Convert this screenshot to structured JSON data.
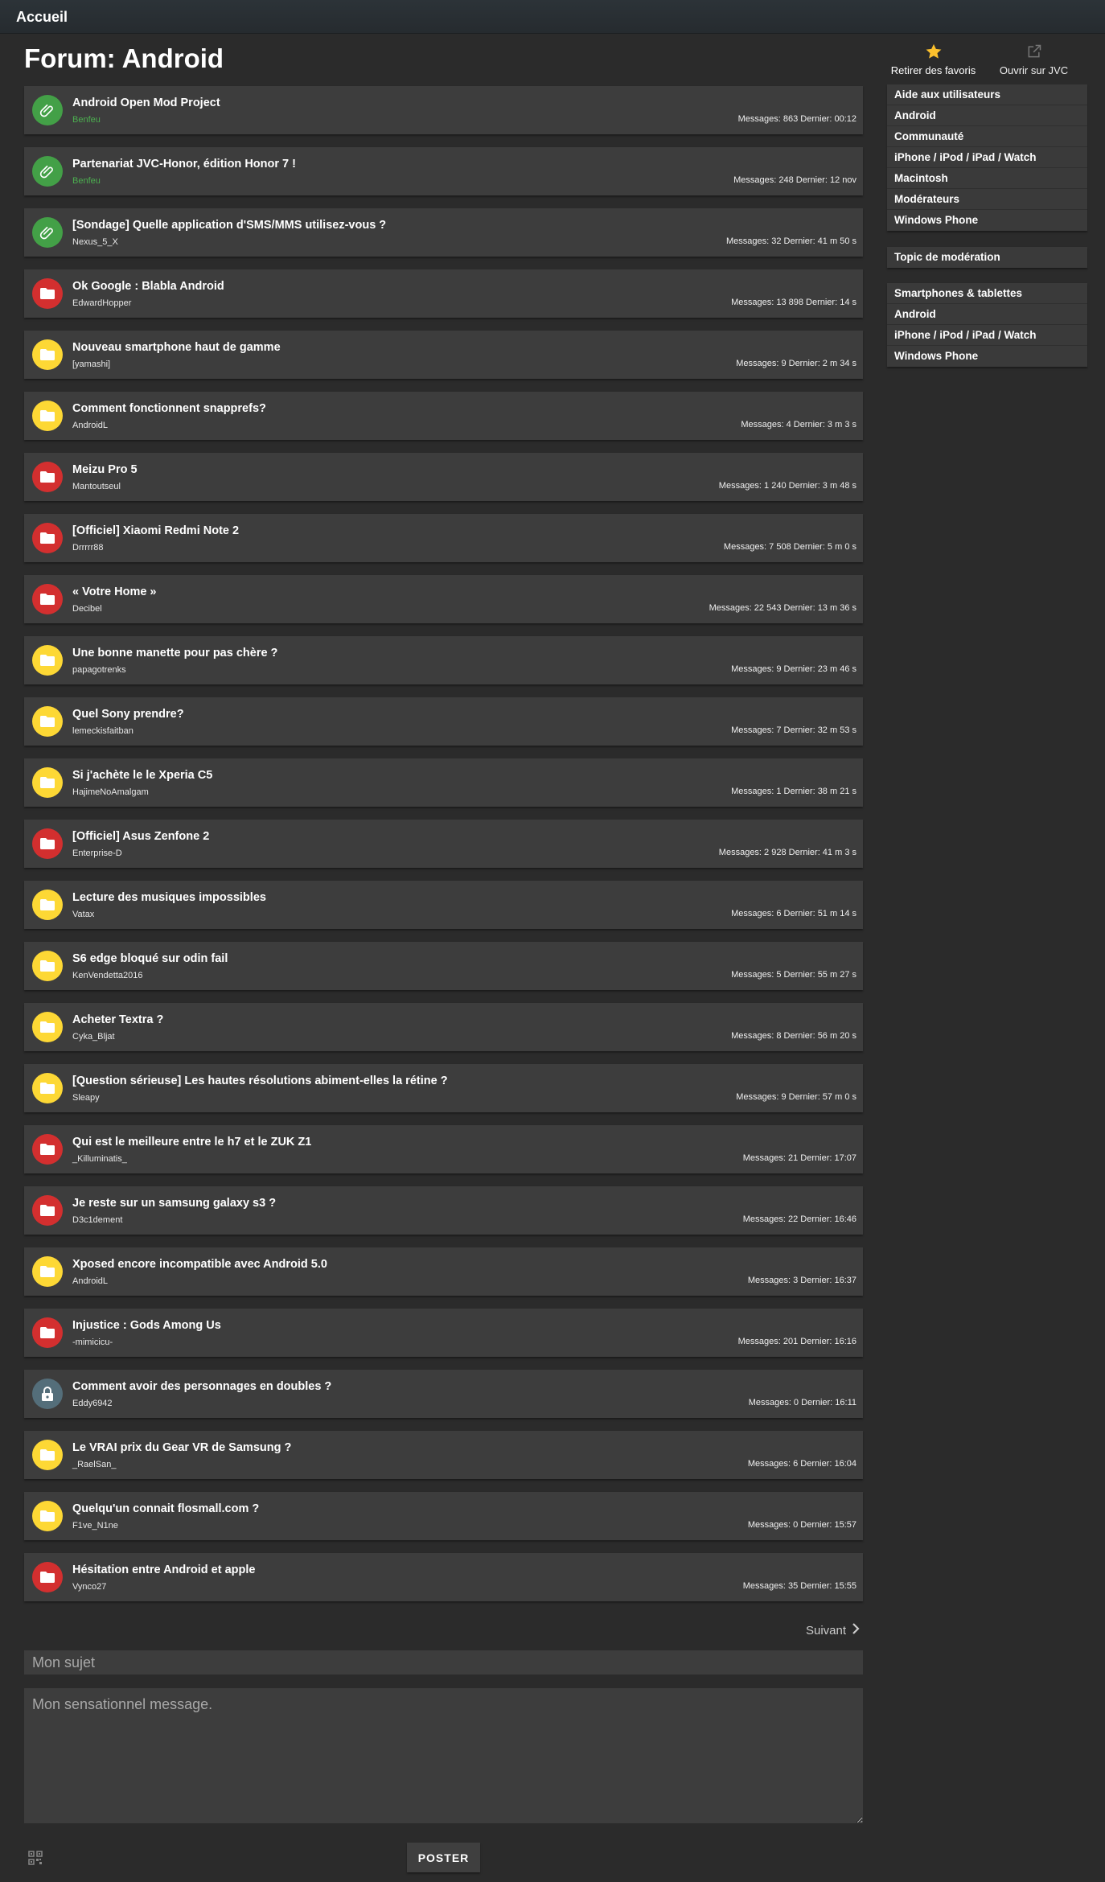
{
  "header": {
    "home_label": "Accueil"
  },
  "forum": {
    "title": "Forum: Android",
    "actions": {
      "favorite_label": "Retirer des favoris",
      "open_jvc_label": "Ouvrir sur JVC"
    }
  },
  "colors": {
    "pinned": "#43a047",
    "hot": "#d32f2f",
    "normal": "#fdd835",
    "locked": "#546e7a",
    "moderator": "#4caf50",
    "star": "#fbc02d"
  },
  "topics": [
    {
      "kind": "pinned",
      "icon": "paperclip-icon",
      "title": "Android Open Mod Project",
      "author": "Benfeu",
      "author_mod": true,
      "meta": "Messages: 863 Dernier: 00:12"
    },
    {
      "kind": "pinned",
      "icon": "paperclip-icon",
      "title": "Partenariat JVC-Honor, édition Honor 7 !",
      "author": "Benfeu",
      "author_mod": true,
      "meta": "Messages: 248 Dernier: 12 nov"
    },
    {
      "kind": "pinned",
      "icon": "paperclip-icon",
      "title": "[Sondage] Quelle application d'SMS/MMS utilisez-vous ?",
      "author": "Nexus_5_X",
      "author_mod": false,
      "meta": "Messages: 32 Dernier: 41 m 50 s"
    },
    {
      "kind": "hot",
      "icon": "folder-icon",
      "title": "Ok Google : Blabla Android",
      "author": "EdwardHopper",
      "author_mod": false,
      "meta": "Messages: 13 898 Dernier: 14 s"
    },
    {
      "kind": "normal",
      "icon": "folder-icon",
      "title": "Nouveau smartphone haut de gamme",
      "author": "[yamashi]",
      "author_mod": false,
      "meta": "Messages: 9 Dernier: 2 m 34 s"
    },
    {
      "kind": "normal",
      "icon": "folder-icon",
      "title": "Comment fonctionnent snapprefs?",
      "author": "AndroidL",
      "author_mod": false,
      "meta": "Messages: 4 Dernier: 3 m 3 s"
    },
    {
      "kind": "hot",
      "icon": "folder-icon",
      "title": "Meizu Pro 5",
      "author": "Mantoutseul",
      "author_mod": false,
      "meta": "Messages: 1 240 Dernier: 3 m 48 s"
    },
    {
      "kind": "hot",
      "icon": "folder-icon",
      "title": "[Officiel] Xiaomi Redmi Note 2",
      "author": "Drrrrr88",
      "author_mod": false,
      "meta": "Messages: 7 508 Dernier: 5 m 0 s"
    },
    {
      "kind": "hot",
      "icon": "folder-icon",
      "title": "« Votre Home »",
      "author": "Decibel",
      "author_mod": false,
      "meta": "Messages: 22 543 Dernier: 13 m 36 s"
    },
    {
      "kind": "normal",
      "icon": "folder-icon",
      "title": "Une bonne manette pour pas chère ?",
      "author": "papagotrenks",
      "author_mod": false,
      "meta": "Messages: 9 Dernier: 23 m 46 s"
    },
    {
      "kind": "normal",
      "icon": "folder-icon",
      "title": "Quel Sony prendre?",
      "author": "lemeckisfaitban",
      "author_mod": false,
      "meta": "Messages: 7 Dernier: 32 m 53 s"
    },
    {
      "kind": "normal",
      "icon": "folder-icon",
      "title": "Si j'achète le le Xperia C5",
      "author": "HajimeNoAmalgam",
      "author_mod": false,
      "meta": "Messages: 1 Dernier: 38 m 21 s"
    },
    {
      "kind": "hot",
      "icon": "folder-icon",
      "title": "[Officiel] Asus Zenfone 2",
      "author": "Enterprise-D",
      "author_mod": false,
      "meta": "Messages: 2 928 Dernier: 41 m 3 s"
    },
    {
      "kind": "normal",
      "icon": "folder-icon",
      "title": "Lecture des musiques impossibles",
      "author": "Vatax",
      "author_mod": false,
      "meta": "Messages: 6 Dernier: 51 m 14 s"
    },
    {
      "kind": "normal",
      "icon": "folder-icon",
      "title": "S6 edge bloqué sur odin fail",
      "author": "KenVendetta2016",
      "author_mod": false,
      "meta": "Messages: 5 Dernier: 55 m 27 s"
    },
    {
      "kind": "normal",
      "icon": "folder-icon",
      "title": "Acheter Textra ?",
      "author": "Cyka_Bljat",
      "author_mod": false,
      "meta": "Messages: 8 Dernier: 56 m 20 s"
    },
    {
      "kind": "normal",
      "icon": "folder-icon",
      "title": "[Question sérieuse] Les hautes résolutions abiment-elles la rétine ?",
      "author": "Sleapy",
      "author_mod": false,
      "meta": "Messages: 9 Dernier: 57 m 0 s"
    },
    {
      "kind": "hot",
      "icon": "folder-icon",
      "title": "Qui est le meilleure entre le h7 et le ZUK Z1",
      "author": "_Killuminatis_",
      "author_mod": false,
      "meta": "Messages: 21 Dernier: 17:07"
    },
    {
      "kind": "hot",
      "icon": "folder-icon",
      "title": "Je reste sur un samsung galaxy s3 ?",
      "author": "D3c1dement",
      "author_mod": false,
      "meta": "Messages: 22 Dernier: 16:46"
    },
    {
      "kind": "normal",
      "icon": "folder-icon",
      "title": "Xposed encore incompatible avec Android 5.0",
      "author": "AndroidL",
      "author_mod": false,
      "meta": "Messages: 3 Dernier: 16:37"
    },
    {
      "kind": "hot",
      "icon": "folder-icon",
      "title": "Injustice : Gods Among Us",
      "author": "-mimicicu-",
      "author_mod": false,
      "meta": "Messages: 201 Dernier: 16:16"
    },
    {
      "kind": "locked",
      "icon": "lock-icon",
      "title": "Comment avoir des personnages en doubles ?",
      "author": "Eddy6942",
      "author_mod": false,
      "meta": "Messages: 0 Dernier: 16:11"
    },
    {
      "kind": "normal",
      "icon": "folder-icon",
      "title": "Le VRAI prix du Gear VR de Samsung ?",
      "author": "_RaelSan_",
      "author_mod": false,
      "meta": "Messages: 6 Dernier: 16:04"
    },
    {
      "kind": "normal",
      "icon": "folder-icon",
      "title": "Quelqu'un connait flosmall.com ?",
      "author": "F1ve_N1ne",
      "author_mod": false,
      "meta": "Messages: 0 Dernier: 15:57"
    },
    {
      "kind": "hot",
      "icon": "folder-icon",
      "title": "Hésitation entre Android et apple",
      "author": "Vynco27",
      "author_mod": false,
      "meta": "Messages: 35 Dernier: 15:55"
    }
  ],
  "sidebar": {
    "forums": [
      "Aide aux utilisateurs",
      "Android",
      "Communauté",
      "iPhone / iPod / iPad / Watch",
      "Macintosh",
      "Modérateurs",
      "Windows Phone"
    ],
    "moderation": [
      "Topic de modération"
    ],
    "related": {
      "heading": "Smartphones & tablettes",
      "items": [
        "Android",
        "iPhone / iPod / iPad / Watch",
        "Windows Phone"
      ]
    }
  },
  "pagination": {
    "next_label": "Suivant"
  },
  "form": {
    "subject_placeholder": "Mon sujet",
    "message_placeholder": "Mon sensationnel message.",
    "post_label": "POSTER"
  }
}
